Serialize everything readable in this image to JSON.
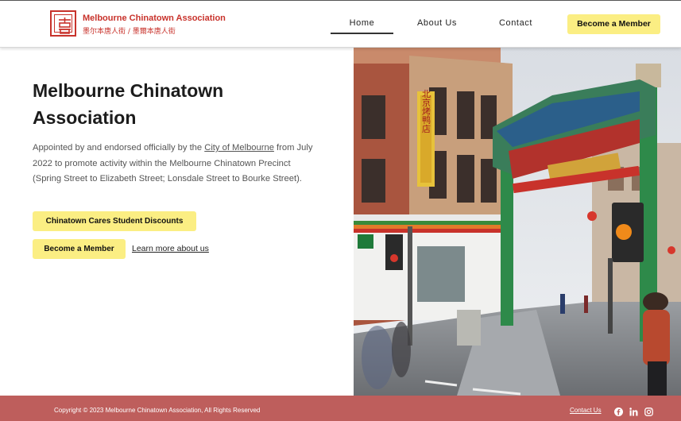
{
  "header": {
    "brand_name": "Melbourne Chinatown Association",
    "brand_sub": "墨尔本唐人街 / 墨爾本唐人街",
    "logo_icon": "chinese-seal-logo-icon",
    "nav": [
      {
        "label": "Home",
        "active": true
      },
      {
        "label": "About Us",
        "active": false
      },
      {
        "label": "Contact",
        "active": false
      }
    ],
    "cta_label": "Become a Member"
  },
  "hero": {
    "title": "Melbourne Chinatown Association",
    "text_before_link": "Appointed by and endorsed officially by the ",
    "link_text": "City of Melbourne",
    "text_after_link": " from July 2022 to promote activity within the Melbourne Chinatown Precinct (Spring Street to Elizabeth Street; Lonsdale Street to Bourke Street).",
    "discounts_button": "Chinatown Cares Student Discounts",
    "member_button": "Become a Member",
    "learn_more_link": "Learn more about us"
  },
  "photo": {
    "sign_text": "北京烤鸭店"
  },
  "footer": {
    "copyright": "Copyright © 2023 Melbourne Chinatown Association, All Rights Reserved",
    "contact_link": "Contact Us",
    "social_icons": [
      "facebook-icon",
      "linkedin-icon",
      "instagram-icon"
    ]
  },
  "colors": {
    "brand_red": "#c8322b",
    "button_yellow": "#fbee83",
    "footer_bg": "#be5e5c"
  }
}
